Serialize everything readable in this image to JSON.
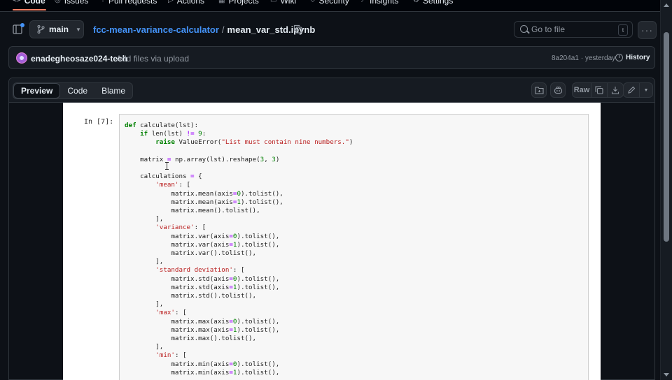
{
  "repo_nav": {
    "tabs": [
      {
        "label": "Code",
        "icon": "code-icon",
        "active": true
      },
      {
        "label": "Issues",
        "icon": "issue-icon"
      },
      {
        "label": "Pull requests",
        "icon": "pull-request-icon"
      },
      {
        "label": "Actions",
        "icon": "play-icon"
      },
      {
        "label": "Projects",
        "icon": "table-icon"
      },
      {
        "label": "Wiki",
        "icon": "book-icon"
      },
      {
        "label": "Security",
        "icon": "shield-icon"
      },
      {
        "label": "Insights",
        "icon": "graph-icon"
      },
      {
        "label": "Settings",
        "icon": "gear-icon"
      }
    ]
  },
  "header": {
    "branch": "main",
    "repo": "fcc-mean-variance-calculator",
    "separator": "/",
    "file": "mean_var_std.ipynb",
    "search_placeholder": "Go to file",
    "search_shortcut": "t"
  },
  "commit": {
    "user": "enadegheosaze024-tech",
    "message": "Add files via upload",
    "meta": "8a204a1 · yesterday",
    "history_label": "History"
  },
  "toolbar": {
    "views": [
      "Preview",
      "Code",
      "Blame"
    ],
    "active_view": "Preview",
    "raw_label": "Raw"
  },
  "notebook": {
    "prompt": "In [7]:",
    "code_lines": [
      "def calculate(lst):",
      "    if len(lst) != 9:",
      "        raise ValueError(\"List must contain nine numbers.\")",
      "",
      "    matrix = np.array(lst).reshape(3, 3)",
      "",
      "    calculations = {",
      "        'mean': [",
      "            matrix.mean(axis=0).tolist(),",
      "            matrix.mean(axis=1).tolist(),",
      "            matrix.mean().tolist(),",
      "        ],",
      "        'variance': [",
      "            matrix.var(axis=0).tolist(),",
      "            matrix.var(axis=1).tolist(),",
      "            matrix.var().tolist(),",
      "        ],",
      "        'standard deviation': [",
      "            matrix.std(axis=0).tolist(),",
      "            matrix.std(axis=1).tolist(),",
      "            matrix.std().tolist(),",
      "        ],",
      "        'max': [",
      "            matrix.max(axis=0).tolist(),",
      "            matrix.max(axis=1).tolist(),",
      "            matrix.max().tolist(),",
      "        ],",
      "        'min': [",
      "            matrix.min(axis=0).tolist(),",
      "            matrix.min(axis=1).tolist(),"
    ]
  }
}
